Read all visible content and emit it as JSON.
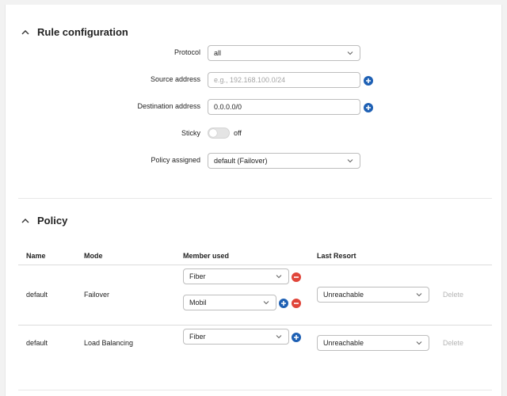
{
  "rule_section": {
    "title": "Rule configuration",
    "protocol": {
      "label": "Protocol",
      "value": "all"
    },
    "source": {
      "label": "Source address",
      "value": "",
      "placeholder": "e.g., 192.168.100.0/24"
    },
    "destination": {
      "label": "Destination address",
      "value": "0.0.0.0/0"
    },
    "sticky": {
      "label": "Sticky",
      "state": "off"
    },
    "policy_assigned": {
      "label": "Policy assigned",
      "value": "default (Failover)"
    }
  },
  "policy_section": {
    "title": "Policy",
    "columns": [
      "Name",
      "Mode",
      "Member used",
      "Last Resort"
    ],
    "rows": [
      {
        "name": "default",
        "mode": "Failover",
        "members": [
          "Fiber",
          "Mobil"
        ],
        "last_resort": "Unreachable",
        "delete_label": "Delete"
      },
      {
        "name": "default",
        "mode": "Load Balancing",
        "members": [
          "Fiber"
        ],
        "last_resort": "Unreachable",
        "delete_label": "Delete"
      }
    ]
  },
  "colors": {
    "plus": "#1e60b4",
    "minus": "#e0453a",
    "border": "#bdbdbd",
    "muted": "#b5b5b5"
  },
  "icons": [
    "chevron-up-icon",
    "chevron-down-icon",
    "plus-circle-icon",
    "minus-circle-icon"
  ]
}
